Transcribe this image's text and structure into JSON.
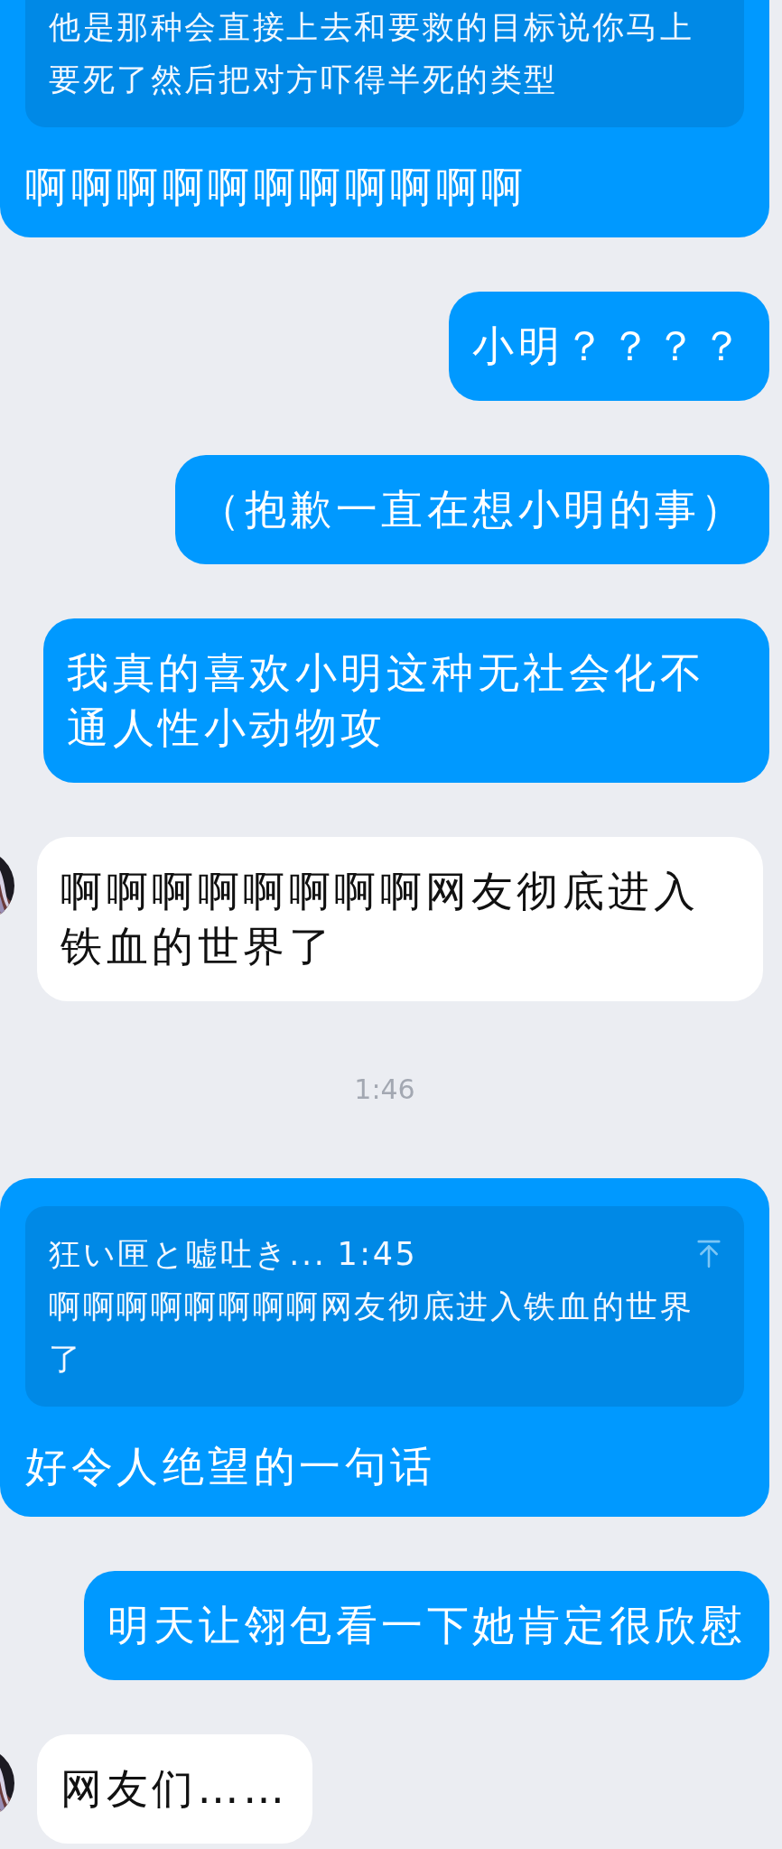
{
  "messages": [
    {
      "kind": "outgoing",
      "quote": {
        "text": "他是那种会直接上去和要救的目标说你马上要死了然后把对方吓得半死的类型"
      },
      "text": "啊啊啊啊啊啊啊啊啊啊啊"
    },
    {
      "kind": "outgoing",
      "text": "小明？？？？"
    },
    {
      "kind": "outgoing",
      "text": "（抱歉一直在想小明的事）"
    },
    {
      "kind": "outgoing",
      "text": "我真的喜欢小明这种无社会化不通人性小动物攻"
    },
    {
      "kind": "incoming",
      "text": "啊啊啊啊啊啊啊啊网友彻底进入铁血的世界了"
    },
    {
      "kind": "time",
      "text": "1:46"
    },
    {
      "kind": "outgoing",
      "quote": {
        "sender": "狂い匣と嘘吐き...",
        "time": "1:45",
        "text": "啊啊啊啊啊啊啊啊网友彻底进入铁血的世界了"
      },
      "text": "好令人绝望的一句话"
    },
    {
      "kind": "outgoing",
      "text": "明天让翎包看一下她肯定很欣慰"
    },
    {
      "kind": "incoming",
      "text": "网友们……"
    }
  ]
}
